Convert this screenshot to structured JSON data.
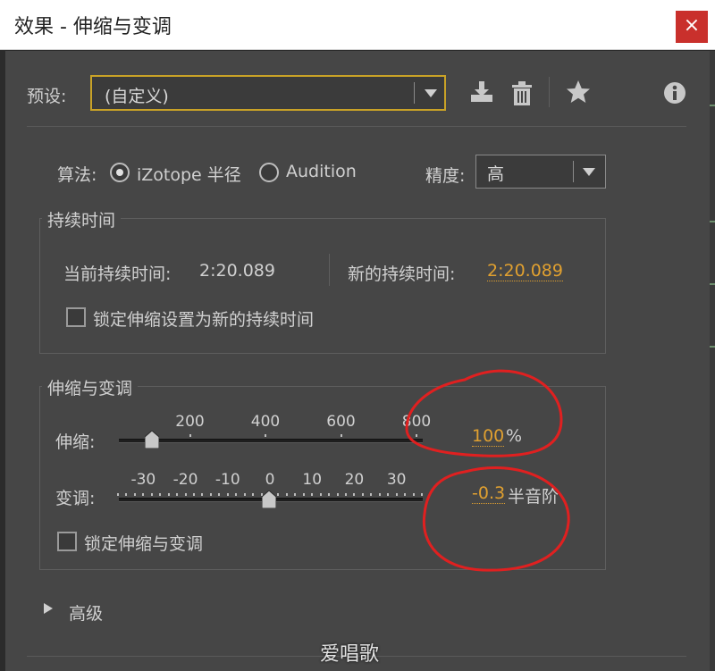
{
  "window": {
    "title": "效果 - 伸缩与变调",
    "close_glyph": "×"
  },
  "preset": {
    "label": "预设:",
    "value": "(自定义)"
  },
  "algorithm": {
    "label": "算法:",
    "options": [
      {
        "label": "iZotope 半径",
        "selected": true
      },
      {
        "label": "Audition",
        "selected": false
      }
    ]
  },
  "precision": {
    "label": "精度:",
    "value": "高"
  },
  "duration": {
    "group_title": "持续时间",
    "current_label": "当前持续时间:",
    "current_value": "2:20.089",
    "new_label": "新的持续时间:",
    "new_value": "2:20.089",
    "lock_label": "锁定伸缩设置为新的持续时间"
  },
  "stretch_pitch": {
    "group_title": "伸缩与变调",
    "stretch": {
      "label": "伸缩:",
      "ticks": [
        "200",
        "400",
        "600",
        "800"
      ],
      "min": 0,
      "max": 800,
      "value": 100,
      "display_value": "100",
      "unit": "%"
    },
    "pitch": {
      "label": "变调:",
      "ticks": [
        "-30",
        "-20",
        "-10",
        "0",
        "10",
        "20",
        "30"
      ],
      "min": -36,
      "max": 36,
      "value": -0.3,
      "display_value": "-0.3",
      "unit": "半音阶"
    },
    "lock_label": "锁定伸缩与变调"
  },
  "advanced": {
    "label": "高级"
  },
  "watermark": "爱唱歌",
  "icons": [
    "save-preset-icon",
    "delete-preset-icon",
    "favorite-star-icon",
    "info-icon"
  ],
  "colors": {
    "accent": "#e0a030",
    "highlight_border": "#c9a227",
    "annotation": "#e02020",
    "close": "#c9302c"
  }
}
